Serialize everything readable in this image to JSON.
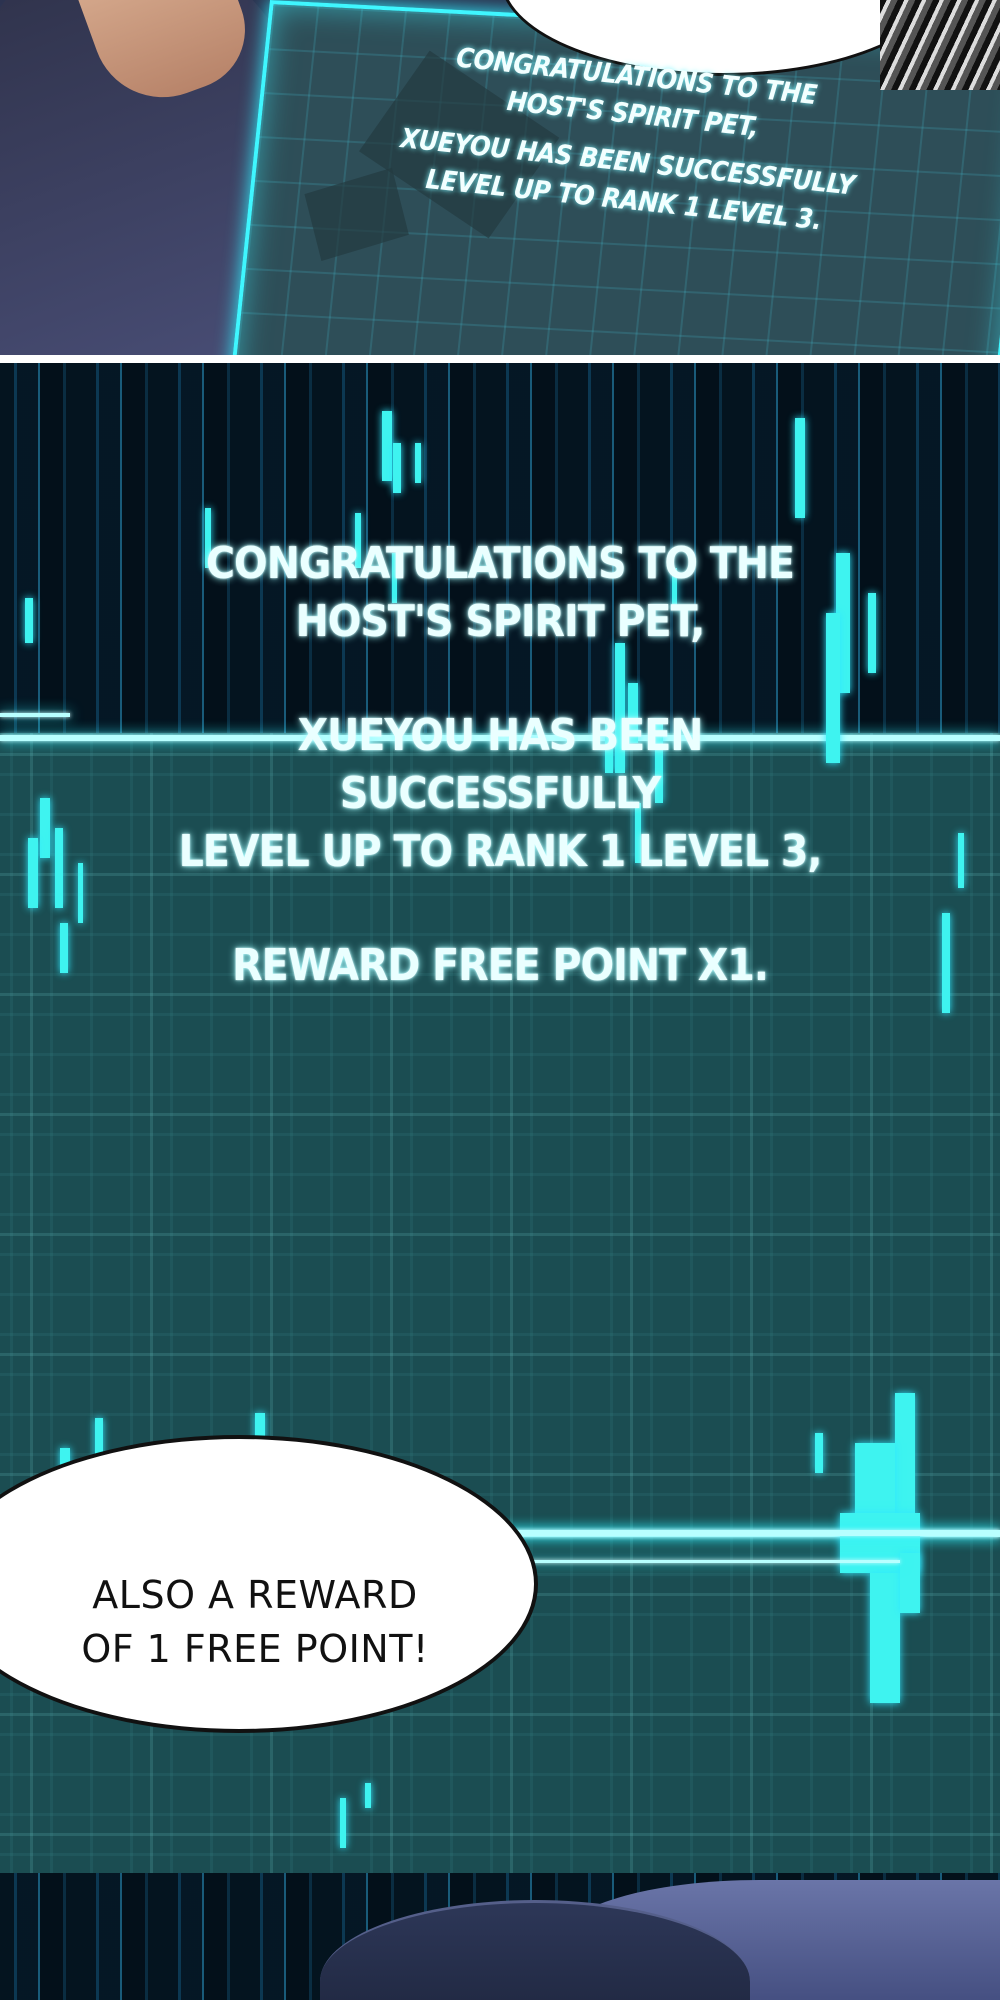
{
  "panel_top": {
    "system_lines": [
      "CONGRATULATIONS TO THE",
      "HOST'S SPIRIT PET,",
      "XUEYOU HAS BEEN SUCCESSFULLY",
      "LEVEL UP TO RANK 1 LEVEL 3."
    ]
  },
  "panel_main": {
    "line1": "CONGRATULATIONS TO THE",
    "line2": "HOST'S SPIRIT PET,",
    "line3": "XUEYOU HAS BEEN SUCCESSFULLY",
    "line4": "LEVEL UP TO RANK 1 LEVEL 3,",
    "line5": "REWARD FREE POINT X1."
  },
  "speech_bubble": {
    "line1": "ALSO A REWARD",
    "line2": "OF 1 FREE POINT!"
  },
  "colors": {
    "system_glow": "#3ff6ff",
    "panel_bg": "#1b4d52",
    "bubble": "#ffffff"
  }
}
